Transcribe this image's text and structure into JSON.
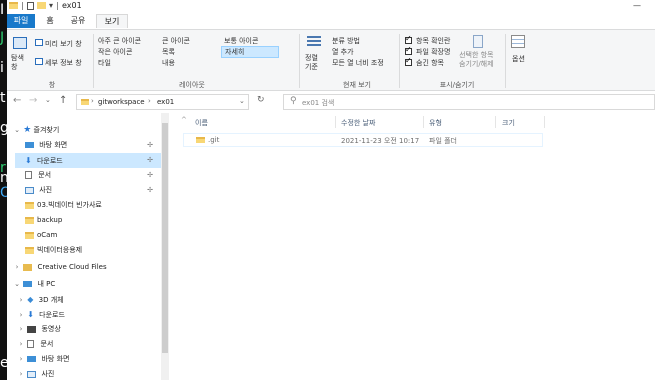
{
  "window": {
    "title": "ex01",
    "minimize_glyph": "—"
  },
  "background_chars": [
    "I",
    "J",
    "i",
    "t",
    "g",
    "r",
    "n",
    "O",
    "e"
  ],
  "ribbon": {
    "tabs": [
      {
        "label": "파일",
        "kind": "file"
      },
      {
        "label": "홈",
        "kind": "normal"
      },
      {
        "label": "공유",
        "kind": "normal"
      },
      {
        "label": "보기",
        "kind": "active"
      }
    ],
    "pane_group": {
      "nav_pane": "탐색\n창",
      "preview": "미리 보기 창",
      "details": "세부 정보 창",
      "label": "창"
    },
    "layout_group": {
      "items": [
        "아주 큰 아이콘",
        "큰 아이콘",
        "보통 아이콘",
        "작은 아이콘",
        "목록",
        "자세히",
        "타일",
        "내용"
      ],
      "label": "레이아웃"
    },
    "view_group": {
      "sort": "정렬\n기준",
      "group_by": "분류 방법",
      "add_columns": "열 추가",
      "fit_columns": "모든 열 너비 조정",
      "label": "현재 보기"
    },
    "showhide_group": {
      "item_checkboxes": "항목 확인란",
      "file_extensions": "파일 확장명",
      "hidden_items": "숨긴 항목",
      "hide_selected": "선택한 항목\n숨기기/해제",
      "options": "옵션",
      "label": "표시/숨기기"
    }
  },
  "address": {
    "path": [
      "gitworkspace",
      "ex01"
    ],
    "search_placeholder": "ex01 검색"
  },
  "nav": {
    "quick_access": "즐겨찾기",
    "items": [
      {
        "label": "바탕 화면",
        "pinned": true,
        "icon": "desktop-icon"
      },
      {
        "label": "다운로드",
        "pinned": true,
        "icon": "download-icon",
        "selected": true
      },
      {
        "label": "문서",
        "pinned": true,
        "icon": "document-icon"
      },
      {
        "label": "사진",
        "pinned": true,
        "icon": "picture-icon"
      },
      {
        "label": "03.빅데이터 빈가사료",
        "pinned": false,
        "icon": "folder-icon"
      },
      {
        "label": "backup",
        "pinned": false,
        "icon": "folder-icon"
      },
      {
        "label": "oCam",
        "pinned": false,
        "icon": "folder-icon"
      },
      {
        "label": "빅데이터응용제",
        "pinned": false,
        "icon": "folder-icon"
      }
    ],
    "creative_cloud": "Creative Cloud Files",
    "this_pc": "내 PC",
    "pc_items": [
      {
        "label": "3D 개체",
        "icon": "cube-icon"
      },
      {
        "label": "다운로드",
        "icon": "download-icon"
      },
      {
        "label": "동영상",
        "icon": "video-icon"
      },
      {
        "label": "문서",
        "icon": "document-icon"
      },
      {
        "label": "바탕 화면",
        "icon": "desktop-icon"
      },
      {
        "label": "사진",
        "icon": "picture-icon"
      }
    ]
  },
  "content": {
    "columns": [
      "이름",
      "수정한 날짜",
      "유형",
      "크기"
    ],
    "rows": [
      {
        "name": ".git",
        "date": "2021-11-23 오전 10:17",
        "type": "파일 폴더",
        "size": ""
      }
    ]
  },
  "colors": {
    "file_tab": "#1979ca",
    "selection": "#cce8ff",
    "folder": "#f8d775"
  }
}
